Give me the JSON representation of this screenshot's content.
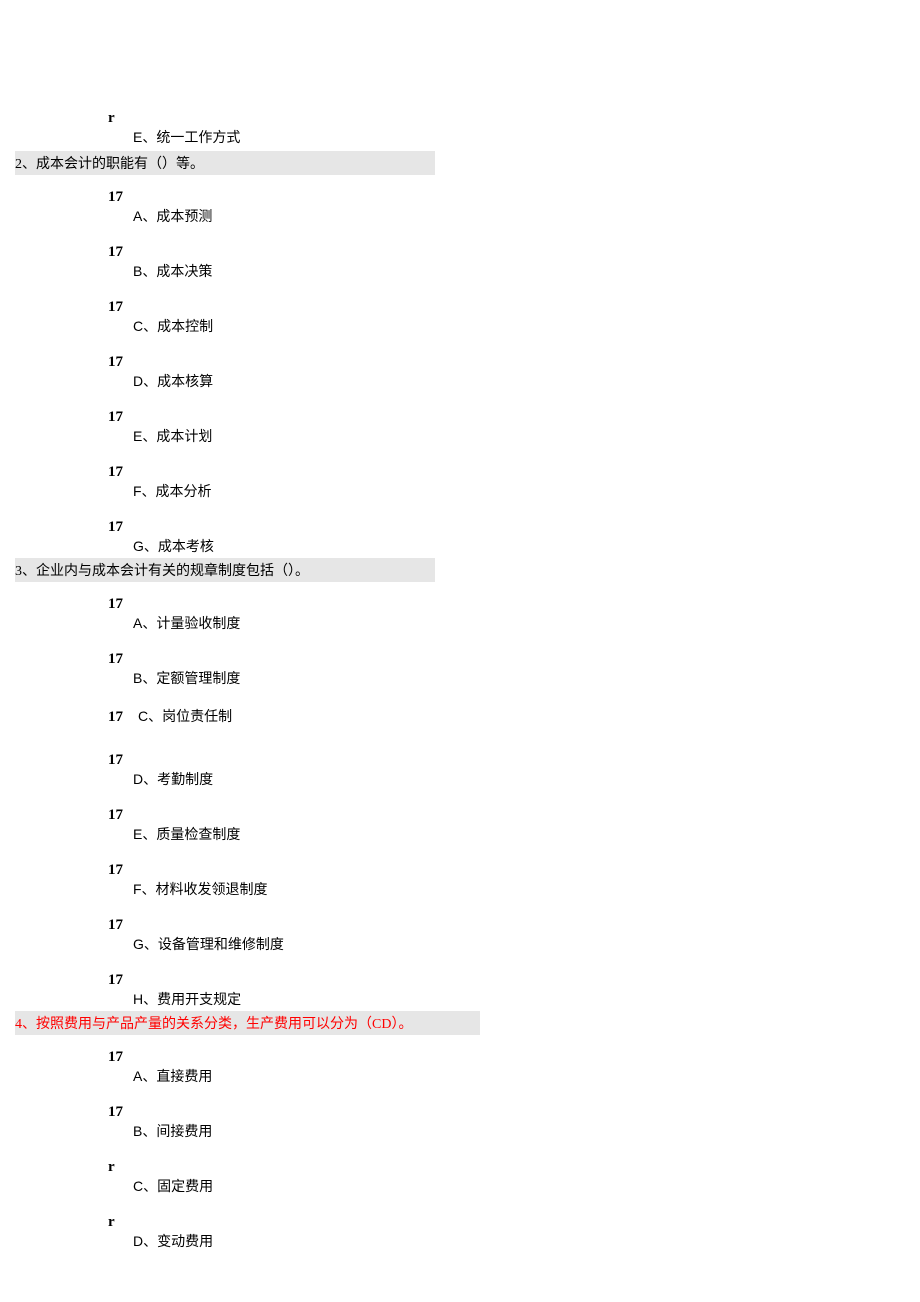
{
  "q1_tail": {
    "e": {
      "marker": "r",
      "text": "E、统一工作方式"
    }
  },
  "q2": {
    "title": "2、成本会计的职能有（）等。",
    "opts": [
      {
        "marker": "17",
        "text": "A、成本预测"
      },
      {
        "marker": "17",
        "text": "B、成本决策"
      },
      {
        "marker": "17",
        "text": "C、成本控制"
      },
      {
        "marker": "17",
        "text": "D、成本核算"
      },
      {
        "marker": "17",
        "text": "E、成本计划"
      },
      {
        "marker": "17",
        "text": "F、成本分析"
      },
      {
        "marker": "17",
        "text": "G、成本考核"
      }
    ]
  },
  "q3": {
    "title": "3、企业内与成本会计有关的规章制度包括（）。",
    "opts": [
      {
        "marker": "17",
        "text": "A、计量验收制度"
      },
      {
        "marker": "17",
        "text": "B、定额管理制度"
      },
      {
        "marker": "17",
        "text": "C、岗位责任制"
      },
      {
        "marker": "17",
        "text": "D、考勤制度"
      },
      {
        "marker": "17",
        "text": "E、质量检查制度"
      },
      {
        "marker": "17",
        "text": "F、材料收发领退制度"
      },
      {
        "marker": "17",
        "text": "G、设备管理和维修制度"
      },
      {
        "marker": "17",
        "text": "H、费用开支规定"
      }
    ]
  },
  "q4": {
    "title": "4、按照费用与产品产量的关系分类，生产费用可以分为（CD）。",
    "opts": [
      {
        "marker": "17",
        "text": "A、直接费用"
      },
      {
        "marker": "17",
        "text": "B、间接费用"
      },
      {
        "marker": "r",
        "text": "C、固定费用"
      },
      {
        "marker": "r",
        "text": "D、变动费用"
      }
    ]
  }
}
